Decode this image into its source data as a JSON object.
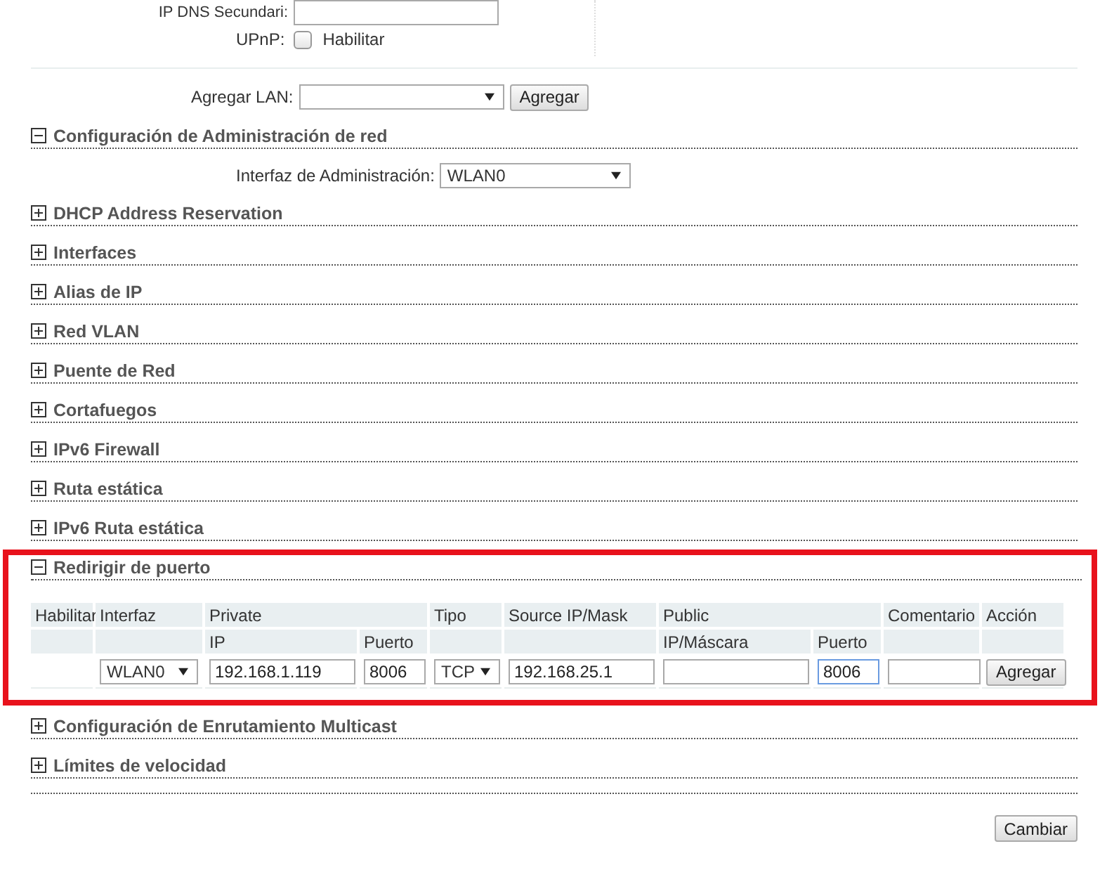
{
  "top_form": {
    "dns_label": "IP DNS Secundari:",
    "upnp_label": "UPnP:",
    "upnp_option": "Habilitar",
    "upnp_checked": false
  },
  "add_lan": {
    "label": "Agregar LAN:",
    "button": "Agregar"
  },
  "sections": [
    {
      "kind": "admin",
      "title": "Configuración de Administración de red",
      "expanded": true,
      "highlighted": false,
      "field_label": "Interfaz de Administración:",
      "field_value": "WLAN0"
    },
    {
      "kind": "plain",
      "title": "DHCP Address Reservation",
      "expanded": false,
      "highlighted": false
    },
    {
      "kind": "plain",
      "title": "Interfaces",
      "expanded": false,
      "highlighted": false
    },
    {
      "kind": "plain",
      "title": "Alias de IP",
      "expanded": false,
      "highlighted": false
    },
    {
      "kind": "plain",
      "title": "Red VLAN",
      "expanded": false,
      "highlighted": false
    },
    {
      "kind": "plain",
      "title": "Puente de Red",
      "expanded": false,
      "highlighted": false
    },
    {
      "kind": "plain",
      "title": "Cortafuegos",
      "expanded": false,
      "highlighted": false
    },
    {
      "kind": "plain",
      "title": "IPv6 Firewall",
      "expanded": false,
      "highlighted": false
    },
    {
      "kind": "plain",
      "title": "Ruta estática",
      "expanded": false,
      "highlighted": false
    },
    {
      "kind": "plain",
      "title": "IPv6 Ruta estática",
      "expanded": false,
      "highlighted": false
    },
    {
      "kind": "ports",
      "title": "Redirigir de puerto",
      "expanded": true,
      "highlighted": true,
      "head1": [
        "Habilitar",
        "Interfaz",
        "Private",
        "Tipo",
        "Source IP/Mask",
        "Public",
        "Comentario",
        "Acción"
      ],
      "head2": [
        "IP",
        "Puerto",
        "IP/Máscara",
        "Puerto"
      ],
      "row": {
        "interface": "WLAN0",
        "private_ip": "192.168.1.119",
        "private_port": "8006",
        "tipo": "TCP",
        "source": "192.168.25.1",
        "public_port": "8006",
        "button": "Agregar"
      }
    },
    {
      "kind": "plain",
      "title": "Configuración de Enrutamiento Multicast",
      "expanded": false,
      "highlighted": false
    },
    {
      "kind": "plain",
      "title": "Límites de velocidad",
      "expanded": false,
      "highlighted": false
    }
  ],
  "save_button": "Cambiar"
}
